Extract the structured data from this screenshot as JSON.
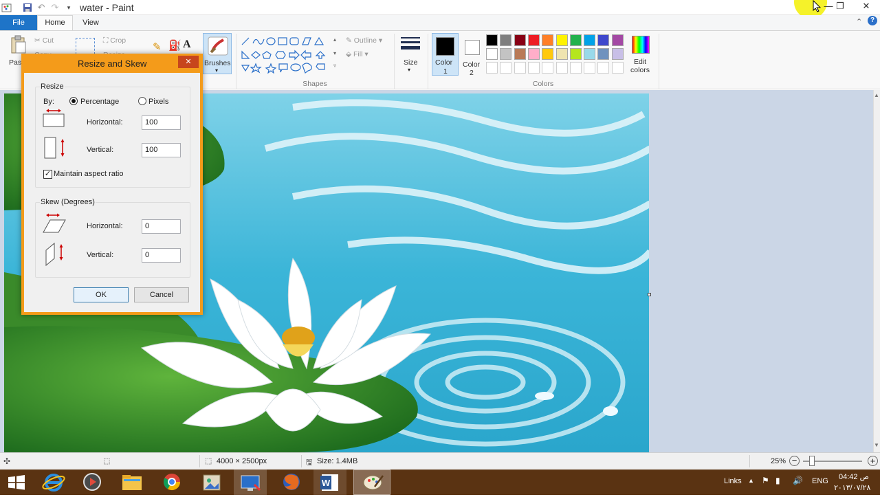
{
  "window": {
    "title": "water - Paint"
  },
  "quick_access": {
    "icons": [
      "paint-app-icon",
      "save-icon",
      "undo-icon",
      "redo-icon",
      "customize-qa-icon"
    ]
  },
  "tabs": [
    {
      "label": "File"
    },
    {
      "label": "Home"
    },
    {
      "label": "View"
    }
  ],
  "ribbon": {
    "clipboard": {
      "paste": "Paste",
      "cut": "Cut",
      "copy": "Copy"
    },
    "image": {
      "crop": "Crop",
      "resize": "Resize"
    },
    "brushes": "Brushes",
    "shapes_label": "Shapes",
    "outline": "Outline",
    "fill": "Fill",
    "size": "Size",
    "color1": "Color",
    "color1_num": "1",
    "color2": "Color",
    "color2_num": "2",
    "colors_label": "Colors",
    "edit_colors_1": "Edit",
    "edit_colors_2": "colors",
    "palette_row1": [
      "#000000",
      "#7f7f7f",
      "#880015",
      "#ed1c24",
      "#ff7f27",
      "#fff200",
      "#22b14c",
      "#00a2e8",
      "#3f48cc",
      "#a349a4"
    ],
    "palette_row2": [
      "#ffffff",
      "#c3c3c3",
      "#b97a57",
      "#ffaec9",
      "#ffc90e",
      "#efe4b0",
      "#b5e61d",
      "#99d9ea",
      "#7092be",
      "#c8bfe7"
    ]
  },
  "dialog": {
    "title": "Resize and Skew",
    "resize_label": "Resize",
    "by_label": "By:",
    "percentage": "Percentage",
    "pixels": "Pixels",
    "horizontal": "Horizontal:",
    "vertical": "Vertical:",
    "resize_h": "100",
    "resize_v": "100",
    "maintain": "Maintain aspect ratio",
    "skew_label": "Skew (Degrees)",
    "skew_h": "0",
    "skew_v": "0",
    "ok": "OK",
    "cancel": "Cancel"
  },
  "status": {
    "dimensions": "4000 × 2500px",
    "size": "Size: 1.4MB",
    "zoom": "25%"
  },
  "taskbar": {
    "links": "Links",
    "lang": "ENG",
    "time": "04:42 ص",
    "date": "٢٠١٣/٠٧/٢٨"
  }
}
